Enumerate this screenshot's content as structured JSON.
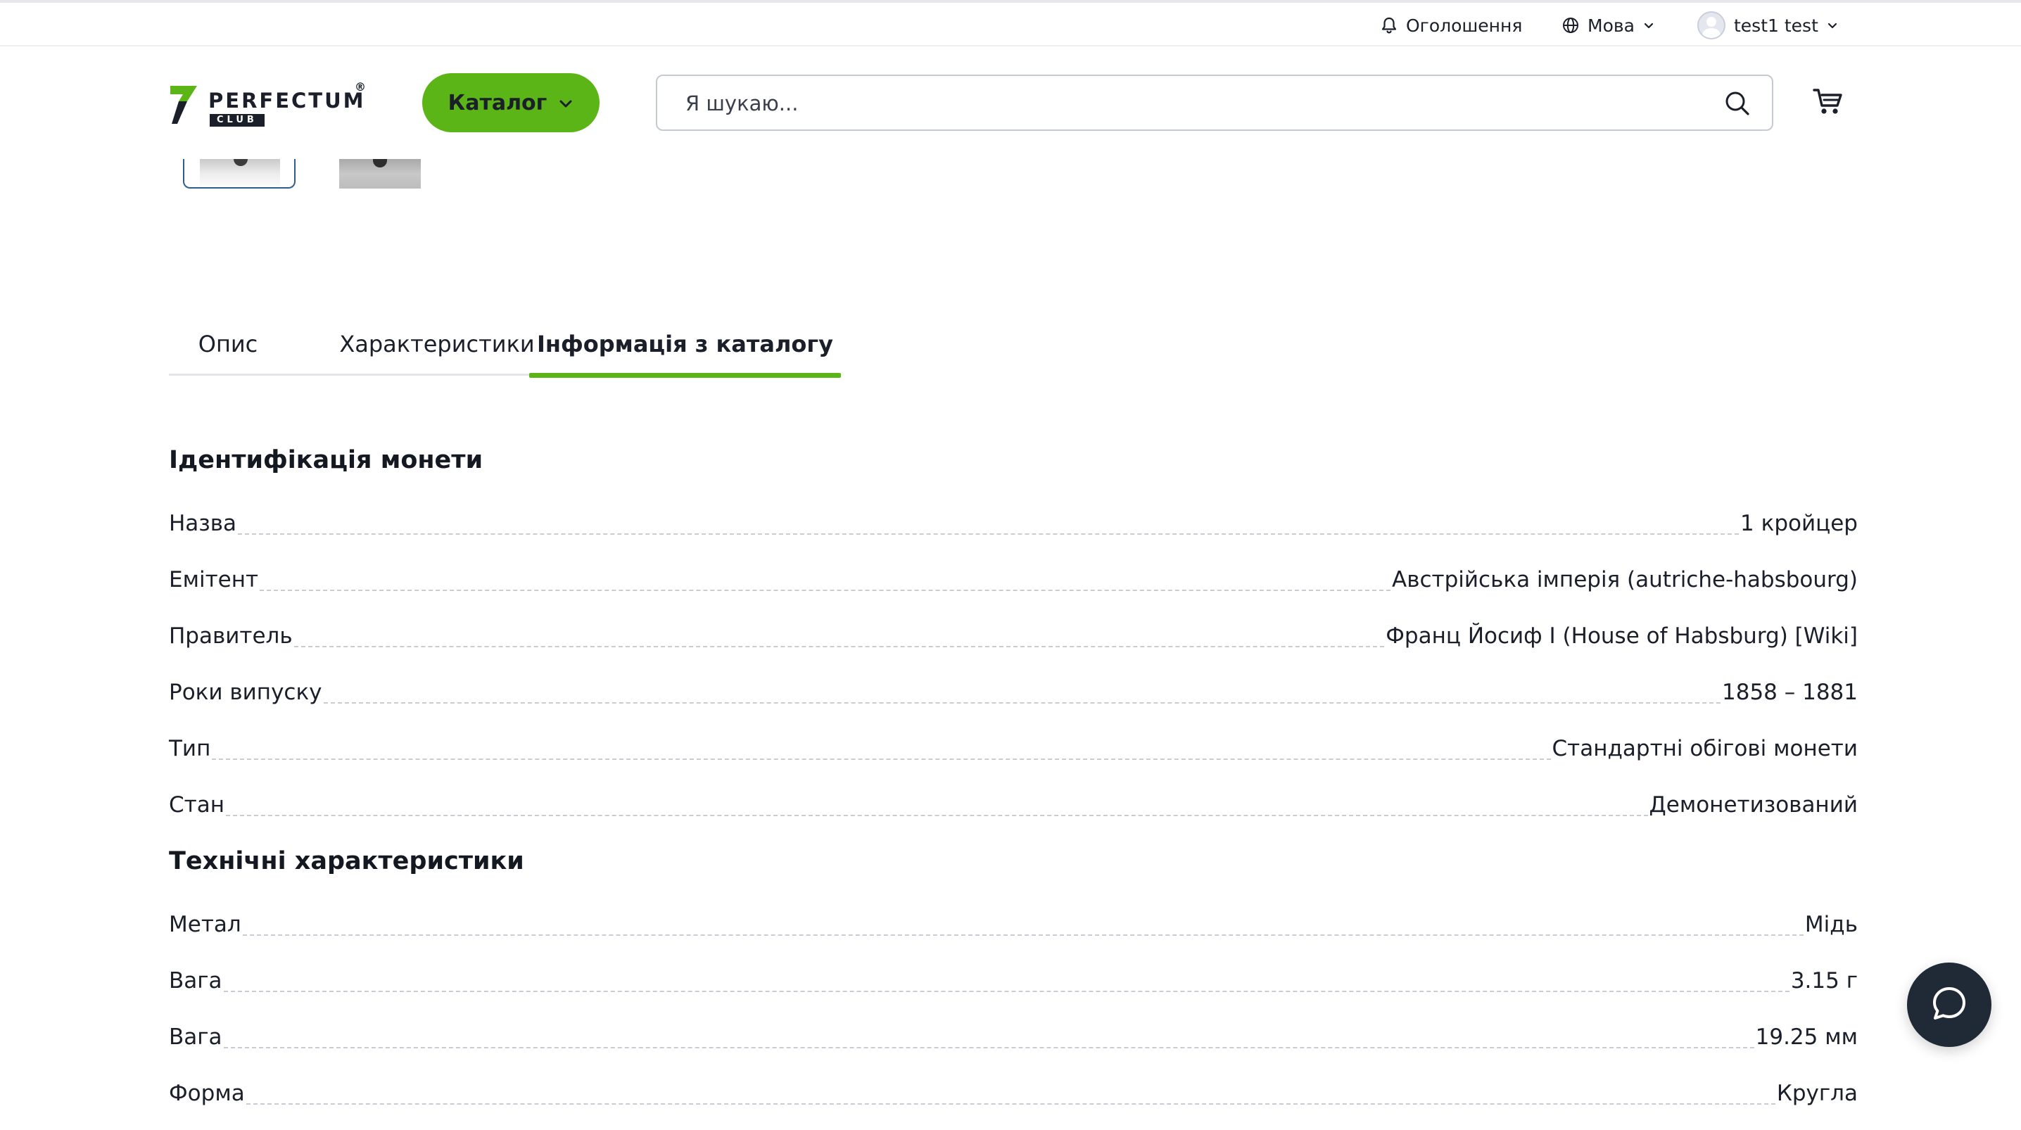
{
  "topbar": {
    "announcements_label": "Оголошення",
    "language_label": "Мова",
    "user_name": "test1 test"
  },
  "header": {
    "logo_text": "PERFECTUM",
    "logo_reg": "®",
    "logo_sub": "CLUB",
    "catalog_label": "Каталог",
    "search_placeholder": "Я шукаю..."
  },
  "tabs": [
    {
      "label": "Опис",
      "active": false
    },
    {
      "label": "Характеристики",
      "active": false
    },
    {
      "label": "Інформація з каталогу",
      "active": true
    }
  ],
  "sections": [
    {
      "title": "Ідентифікація монети",
      "rows": [
        {
          "key": "Назва",
          "value": "1 кройцер"
        },
        {
          "key": "Емітент",
          "value": "Австрійська імперія (autriche-habsbourg)"
        },
        {
          "key": "Правитель",
          "value": "Франц Йосиф I (House of Habsburg) [Wiki]"
        },
        {
          "key": "Роки випуску",
          "value": "1858 – 1881"
        },
        {
          "key": "Тип",
          "value": "Стандартні обігові монети"
        },
        {
          "key": "Стан",
          "value": "Демонетизований"
        }
      ]
    },
    {
      "title": "Технічні характеристики",
      "rows": [
        {
          "key": "Метал",
          "value": "Мідь"
        },
        {
          "key": "Вага",
          "value": "3.15 г"
        },
        {
          "key": "Вага",
          "value": "19.25 мм"
        },
        {
          "key": "Форма",
          "value": "Кругла"
        }
      ]
    }
  ],
  "colors": {
    "accent_green": "#5cb516",
    "chat_button": "#1f2a36",
    "thumb_border": "#2f5d8e"
  },
  "icons": {
    "announcements": "bell-icon",
    "language": "globe-icon",
    "search": "search-icon",
    "cart": "cart-icon",
    "chat": "chat-bubble-icon"
  }
}
